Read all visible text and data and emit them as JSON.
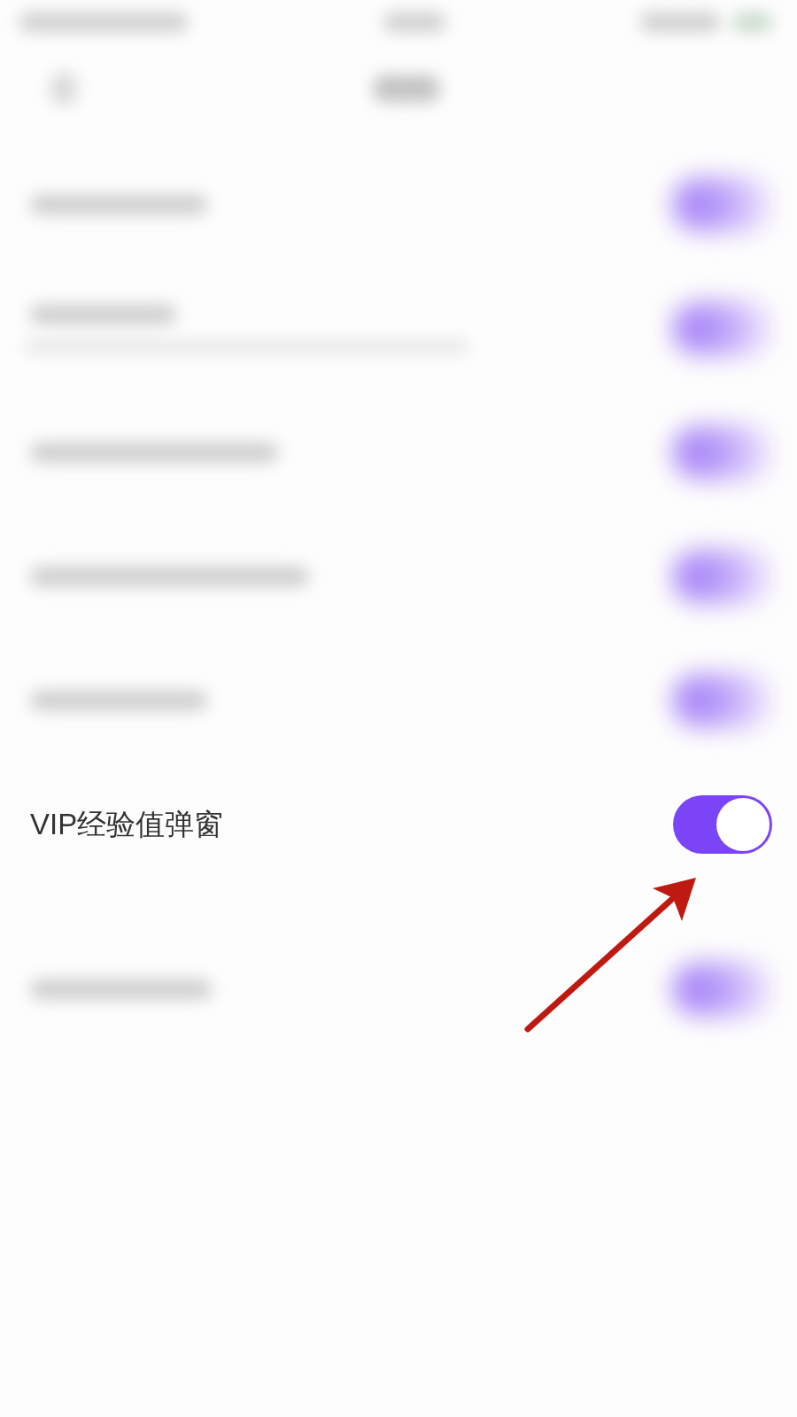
{
  "status_bar": {
    "kind": "blurred"
  },
  "nav_bar": {
    "kind": "blurred"
  },
  "settings": [
    {
      "kind": "blurred",
      "detail": false,
      "on": true
    },
    {
      "kind": "blurred",
      "detail": true,
      "on": true
    },
    {
      "kind": "blurred",
      "detail": false,
      "on": true
    },
    {
      "kind": "blurred",
      "detail": false,
      "on": true
    },
    {
      "kind": "blurred",
      "detail": false,
      "on": true
    },
    {
      "kind": "clear",
      "label": "VIP经验值弹窗",
      "on": true
    },
    {
      "kind": "blurred",
      "detail": false,
      "on": true
    }
  ],
  "annotation": {
    "kind": "arrow"
  }
}
